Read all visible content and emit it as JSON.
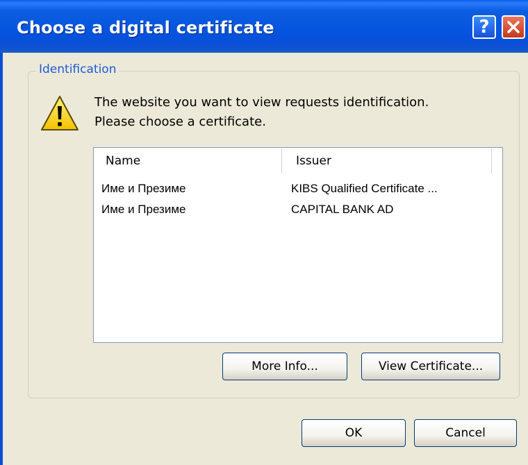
{
  "window": {
    "title": "Choose a digital certificate",
    "help_glyph": "?",
    "title_bar_color": "#0554e0"
  },
  "group": {
    "legend": "Identification"
  },
  "message": {
    "line1": "The website you want to view requests identification.",
    "line2": "Please choose a certificate."
  },
  "list": {
    "columns": [
      "Name",
      "Issuer"
    ],
    "rows": [
      {
        "name": "Име и Презиме",
        "issuer": "KIBS Qualified Certificate ..."
      },
      {
        "name": "Име и Презиме",
        "issuer": "CAPITAL BANK AD"
      }
    ]
  },
  "buttons": {
    "more_info": "More Info...",
    "view_certificate": "View Certificate...",
    "ok": "OK",
    "cancel": "Cancel"
  },
  "icons": {
    "warning": "warning-icon",
    "help": "help-icon",
    "close": "close-icon"
  }
}
